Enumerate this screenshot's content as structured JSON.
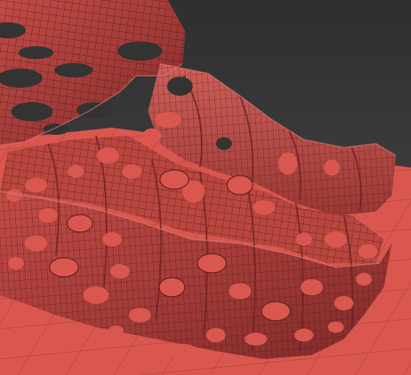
{
  "viewport": {
    "view": "perspective",
    "shading": "wireframe-on-shaded",
    "colors": {
      "background": "#3a3a3a",
      "ground": "#d9574e",
      "mesh": "#b5423f",
      "mesh_dark": "#7e2a29",
      "mesh_light": "#d86a63",
      "wire": "#3a1414"
    }
  }
}
